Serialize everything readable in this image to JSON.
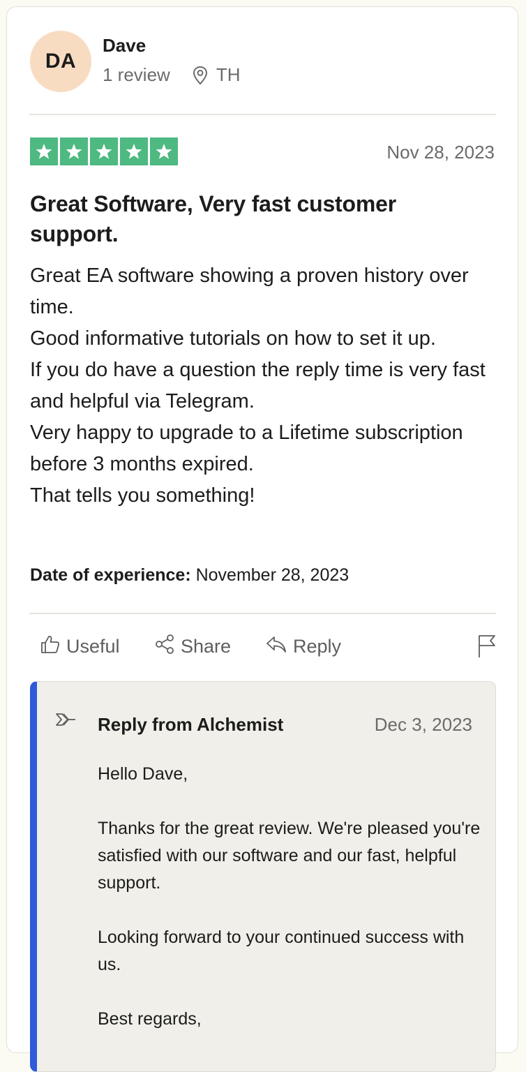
{
  "reviewer": {
    "initials": "DA",
    "name": "Dave",
    "review_count": "1 review",
    "country": "TH"
  },
  "review": {
    "rating": 5,
    "rating_max": 5,
    "star_color": "#4eb981",
    "date": "Nov 28, 2023",
    "title": "Great Software, Very fast customer support.",
    "body": "Great EA software showing a proven history over time.\nGood informative tutorials on how to set it up.\nIf you do have a question the reply time is very fast and helpful via Telegram.\nVery happy to upgrade to a Lifetime subscription before 3 months expired.\nThat tells you something!",
    "experience_label": "Date of experience:",
    "experience_date": "November 28, 2023"
  },
  "actions": {
    "useful_label": "Useful",
    "share_label": "Share",
    "reply_label": "Reply"
  },
  "reply": {
    "from": "Reply from Alchemist",
    "date": "Dec 3, 2023",
    "accent_color": "#2f5ad9",
    "paragraphs": [
      "Hello Dave,",
      "Thanks for the great review. We're pleased you're satisfied with our software and our fast, helpful support.",
      "Looking forward to your continued success with us.",
      "Best regards,"
    ]
  },
  "icons": {
    "location": "location-pin-icon",
    "star": "star-icon",
    "useful": "thumbs-up-icon",
    "share": "share-icon",
    "reply": "reply-arrow-icon",
    "flag": "flag-icon",
    "reply_thread": "reply-thread-arrow-icon"
  }
}
